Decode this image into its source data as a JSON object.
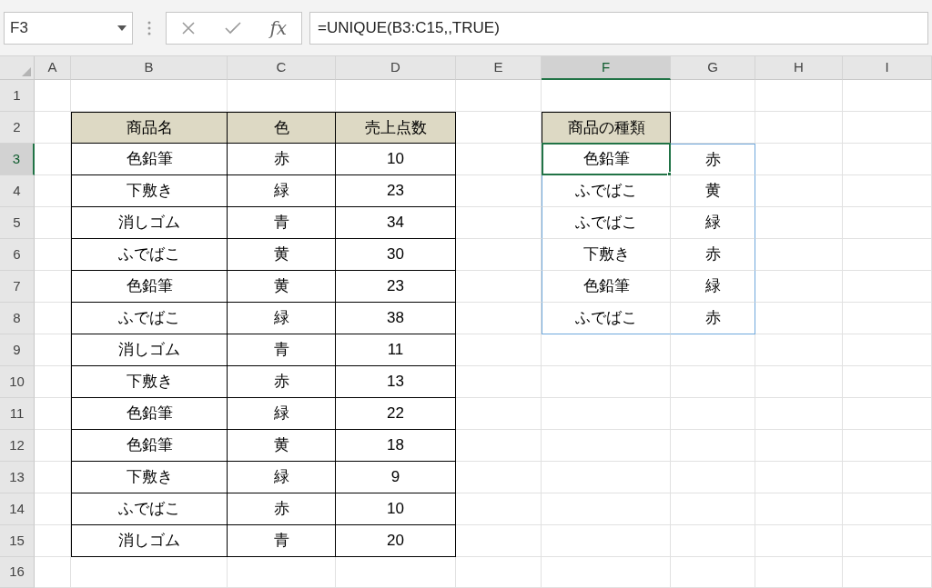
{
  "name_box": "F3",
  "function_button": "fx",
  "formula": "=UNIQUE(B3:C15,,TRUE)",
  "columns": [
    {
      "label": "A",
      "selected": false
    },
    {
      "label": "B",
      "selected": false
    },
    {
      "label": "C",
      "selected": false
    },
    {
      "label": "D",
      "selected": false
    },
    {
      "label": "E",
      "selected": false
    },
    {
      "label": "F",
      "selected": true
    },
    {
      "label": "G",
      "selected": false
    },
    {
      "label": "H",
      "selected": false
    },
    {
      "label": "I",
      "selected": false
    }
  ],
  "rows": [
    {
      "label": "1",
      "selected": false
    },
    {
      "label": "2",
      "selected": false
    },
    {
      "label": "3",
      "selected": true
    },
    {
      "label": "4",
      "selected": false
    },
    {
      "label": "5",
      "selected": false
    },
    {
      "label": "6",
      "selected": false
    },
    {
      "label": "7",
      "selected": false
    },
    {
      "label": "8",
      "selected": false
    },
    {
      "label": "9",
      "selected": false
    },
    {
      "label": "10",
      "selected": false
    },
    {
      "label": "11",
      "selected": false
    },
    {
      "label": "12",
      "selected": false
    },
    {
      "label": "13",
      "selected": false
    },
    {
      "label": "14",
      "selected": false
    },
    {
      "label": "15",
      "selected": false
    },
    {
      "label": "16",
      "selected": false
    }
  ],
  "sales_table": {
    "headers": [
      "商品名",
      "色",
      "売上点数"
    ],
    "rows": [
      [
        "色鉛筆",
        "赤",
        "10"
      ],
      [
        "下敷き",
        "緑",
        "23"
      ],
      [
        "消しゴム",
        "青",
        "34"
      ],
      [
        "ふでばこ",
        "黄",
        "30"
      ],
      [
        "色鉛筆",
        "黄",
        "23"
      ],
      [
        "ふでばこ",
        "緑",
        "38"
      ],
      [
        "消しゴム",
        "青",
        "11"
      ],
      [
        "下敷き",
        "赤",
        "13"
      ],
      [
        "色鉛筆",
        "緑",
        "22"
      ],
      [
        "色鉛筆",
        "黄",
        "18"
      ],
      [
        "下敷き",
        "緑",
        "9"
      ],
      [
        "ふでばこ",
        "赤",
        "10"
      ],
      [
        "消しゴム",
        "青",
        "20"
      ]
    ]
  },
  "unique_result": {
    "header": "商品の種類",
    "spill_highlighted": true,
    "rows": [
      [
        {
          "text": "色鉛筆",
          "selected": true
        },
        {
          "text": "赤",
          "selected": false
        }
      ],
      [
        {
          "text": "ふでばこ",
          "selected": false
        },
        {
          "text": "黄",
          "selected": false
        }
      ],
      [
        {
          "text": "ふでばこ",
          "selected": false
        },
        {
          "text": "緑",
          "selected": false
        }
      ],
      [
        {
          "text": "下敷き",
          "selected": false
        },
        {
          "text": "赤",
          "selected": false
        }
      ],
      [
        {
          "text": "色鉛筆",
          "selected": false
        },
        {
          "text": "緑",
          "selected": false
        }
      ],
      [
        {
          "text": "ふでばこ",
          "selected": false
        },
        {
          "text": "赤",
          "selected": false
        }
      ]
    ]
  }
}
